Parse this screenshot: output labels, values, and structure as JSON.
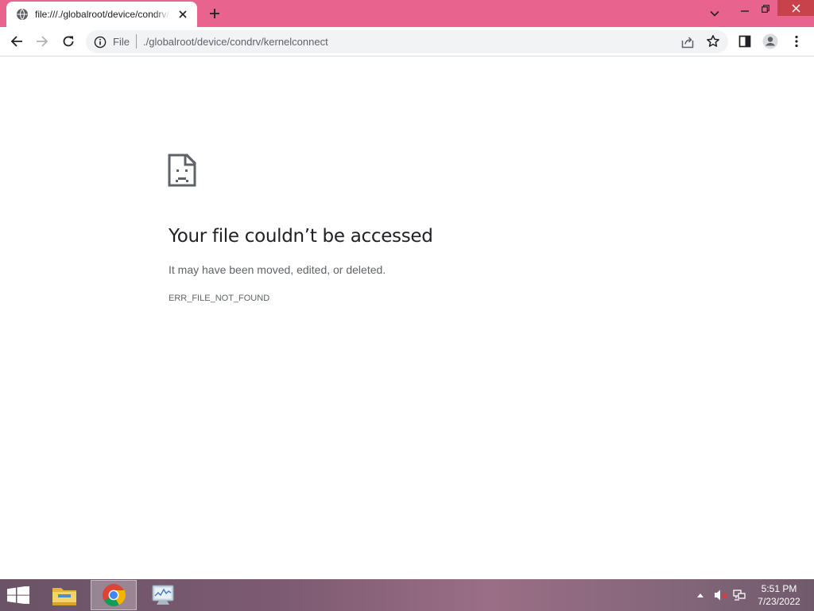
{
  "browser": {
    "tab": {
      "title": "file:///./globalroot/device/condrv/kernelconnect"
    },
    "window_controls": {
      "tab_search": "chevron-down-icon",
      "minimize": "minimize-icon",
      "maximize": "restore-icon",
      "close": "close-icon"
    },
    "accent_color": "#e8638d"
  },
  "toolbar": {
    "omnibox": {
      "scheme_label": "File",
      "url": "./globalroot/device/condrv/kernelconnect"
    }
  },
  "error_page": {
    "icon": "sad-file-icon",
    "heading": "Your file couldn’t be accessed",
    "subtext": "It may have been moved, edited, or deleted.",
    "error_code": "ERR_FILE_NOT_FOUND"
  },
  "taskbar": {
    "items": [
      "file-explorer-icon",
      "chrome-icon",
      "task-manager-icon"
    ],
    "clock": {
      "time": "5:51 PM",
      "date": "7/23/2022"
    }
  }
}
